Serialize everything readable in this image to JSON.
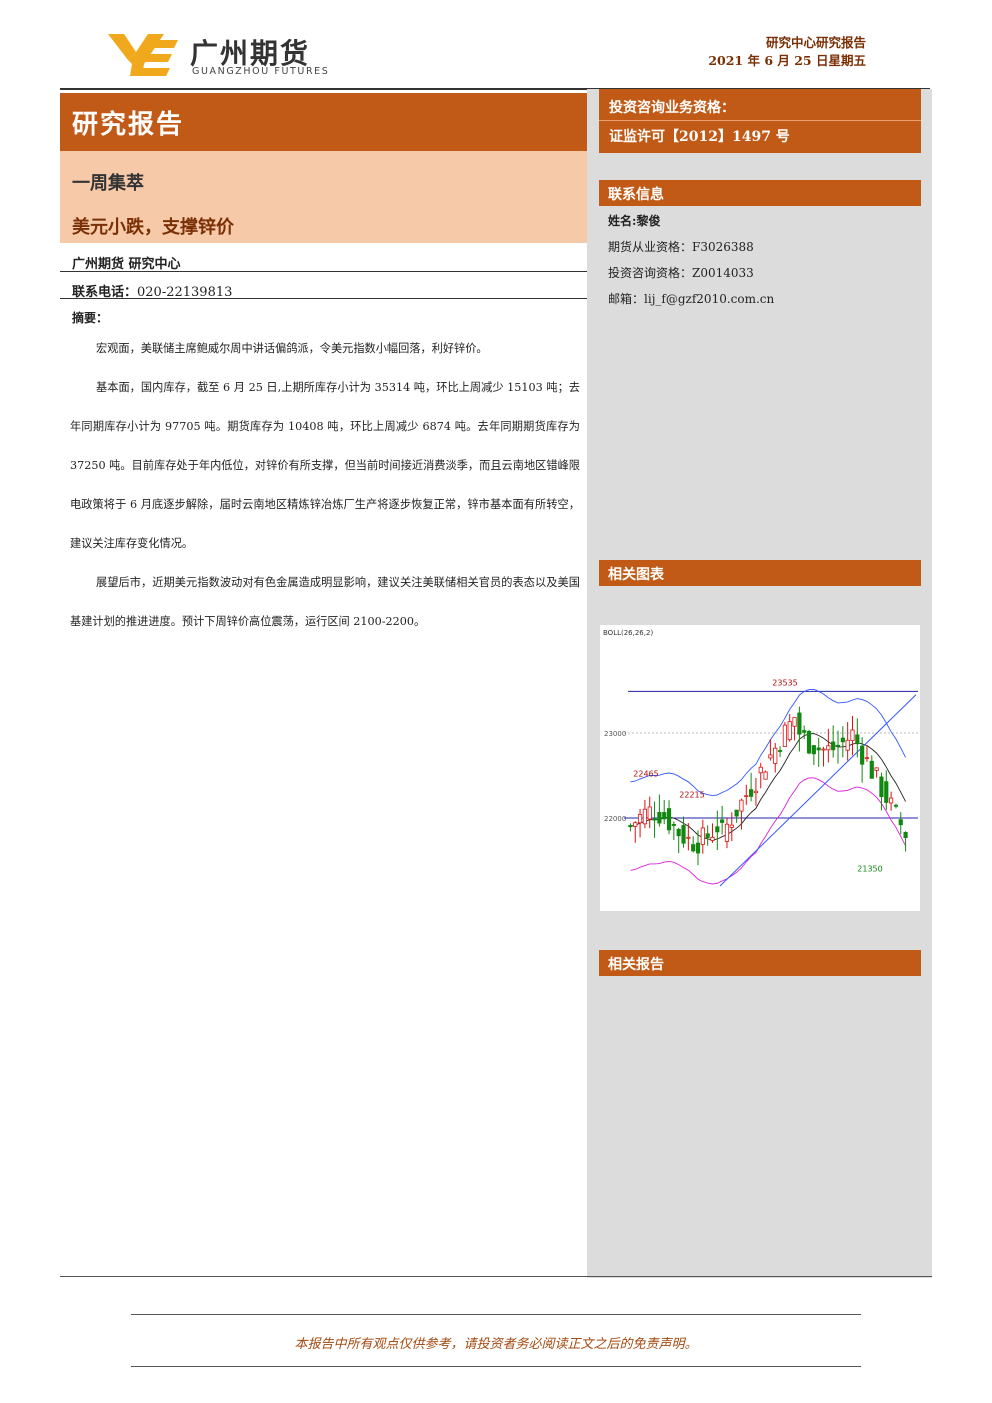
{
  "header": {
    "logo_cn": "广州期货",
    "logo_en": "GUANGZHOU FUTURES",
    "report_type": "研究中心研究报告",
    "date": "2021 年 6 月 25 日星期五"
  },
  "main": {
    "band_title": "研究报告",
    "column": "一周集萃",
    "headline": "美元小跌，支撑锌价",
    "org": "广州期货 研究中心",
    "tel_label": "联系电话：",
    "tel": "020-22139813",
    "abstract_label": "摘要：",
    "paragraphs": [
      "宏观面，美联储主席鲍威尔周中讲话偏鸽派，令美元指数小幅回落，利好锌价。",
      "基本面，国内库存，截至 6 月 25 日,上期所库存小计为 35314 吨，环比上周减少 15103 吨；去年同期库存小计为 97705 吨。期货库存为 10408 吨，环比上周减少 6874 吨。去年同期期货库存为 37250 吨。目前库存处于年内低位，对锌价有所支撑，但当前时间接近消费淡季，而且云南地区错峰限电政策将于 6 月底逐步解除，届时云南地区精炼锌冶炼厂生产将逐步恢复正常，锌市基本面有所转空，建议关注库存变化情况。",
      "展望后市，近期美元指数波动对有色金属造成明显影响，建议关注美联储相关官员的表态以及美国基建计划的推进进度。预计下周锌价高位震荡，运行区间 2100-2200。"
    ]
  },
  "sidebar": {
    "qualification_label": "投资咨询业务资格：",
    "qualification_value": "证监许可【2012】1497 号",
    "contact_head": "联系信息",
    "name_label": "姓名:",
    "name": "黎俊",
    "futures_label": "期货从业资格：",
    "futures_id": "F3026388",
    "consult_label": "投资咨询资格：",
    "consult_id": "Z0014033",
    "email_label": "邮箱：",
    "email": "lij_f@gzf2010.com.cn",
    "charts_head": "相关图表",
    "reports_head": "相关报告"
  },
  "chart_data": {
    "type": "candlestick",
    "indicator": "BOLL(26,26,2)",
    "annotations": [
      "23535",
      "22465",
      "22215",
      "21350"
    ],
    "ylim": [
      21000,
      23800
    ],
    "ticks": [
      "23000",
      "22000"
    ],
    "colors": {
      "up": "#dd1111",
      "down": "#118811",
      "mid": "#222222",
      "upper": "#3355ff",
      "lower": "#dd22dd",
      "ref": "#2222aa"
    }
  },
  "footer": {
    "disclaimer": "本报告中所有观点仅供参考，请投资者务必阅读正文之后的免责声明。"
  }
}
